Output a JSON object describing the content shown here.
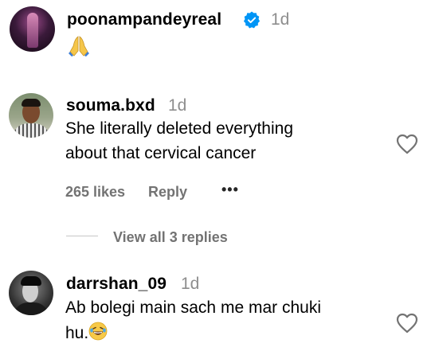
{
  "post": {
    "username": "poonampandeyreal",
    "time": "1d",
    "text": "🙏"
  },
  "comments": [
    {
      "username": "souma.bxd",
      "time": "1d",
      "line1": "She literally deleted everything",
      "line2": "about that cervical cancer",
      "likes": "265 likes",
      "reply": "Reply",
      "more": "•••"
    },
    {
      "username": "darrshan_09",
      "time": "1d",
      "line1": "Ab bolegi main sach me mar chuki",
      "line2": "hu."
    }
  ],
  "view_replies": "View all 3 replies",
  "colors": {
    "verified": "#0095f6",
    "muted": "#737373",
    "time": "#8e8e8e"
  },
  "icons": [
    "verified-badge-icon",
    "heart-icon",
    "more-options-icon",
    "folded-hands-emoji",
    "laughing-emoji"
  ]
}
